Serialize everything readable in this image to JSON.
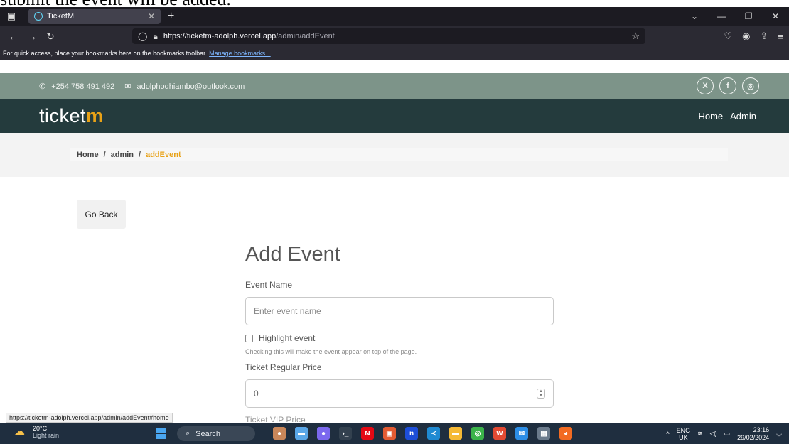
{
  "caption": "submit the event will be added.",
  "browser": {
    "tab_title": "TicketM",
    "url_host": "https://ticketm-adolph.vercel.app",
    "url_path": "/admin/addEvent",
    "bookmarks_text": "For quick access, place your bookmarks here on the bookmarks toolbar.",
    "bookmarks_link": "Manage bookmarks..."
  },
  "contact": {
    "phone": "+254 758 491 492",
    "email": "adolphodhiambo@outlook.com",
    "social_x": "X",
    "social_facebook": "f",
    "social_instagram": "◎"
  },
  "site": {
    "logo_prefix": "ticket",
    "logo_suffix": "m",
    "nav_home": "Home",
    "nav_admin": "Admin"
  },
  "breadcrumb": {
    "home": "Home",
    "admin": "admin",
    "current": "addEvent",
    "separator": "/"
  },
  "page": {
    "go_back": "Go Back",
    "heading": "Add Event"
  },
  "form": {
    "event_name_label": "Event Name",
    "event_name_placeholder": "Enter event name",
    "highlight_label": "Highlight event",
    "highlight_help": "Checking this will make the event appear on top of the page.",
    "regular_price_label": "Ticket Regular Price",
    "regular_price_value": "0",
    "vip_price_label": "Ticket VIP Price"
  },
  "status_link": "https://ticketm-adolph.vercel.app/admin/addEvent#home",
  "taskbar": {
    "temp": "20°C",
    "weather": "Light rain",
    "search": "Search",
    "lang_top": "ENG",
    "lang_bottom": "UK",
    "time": "23:16",
    "date": "29/02/2024"
  },
  "colors": {
    "accent": "#e8a217",
    "nav_bg": "#243b3d",
    "contact_bg": "#7d9489"
  }
}
